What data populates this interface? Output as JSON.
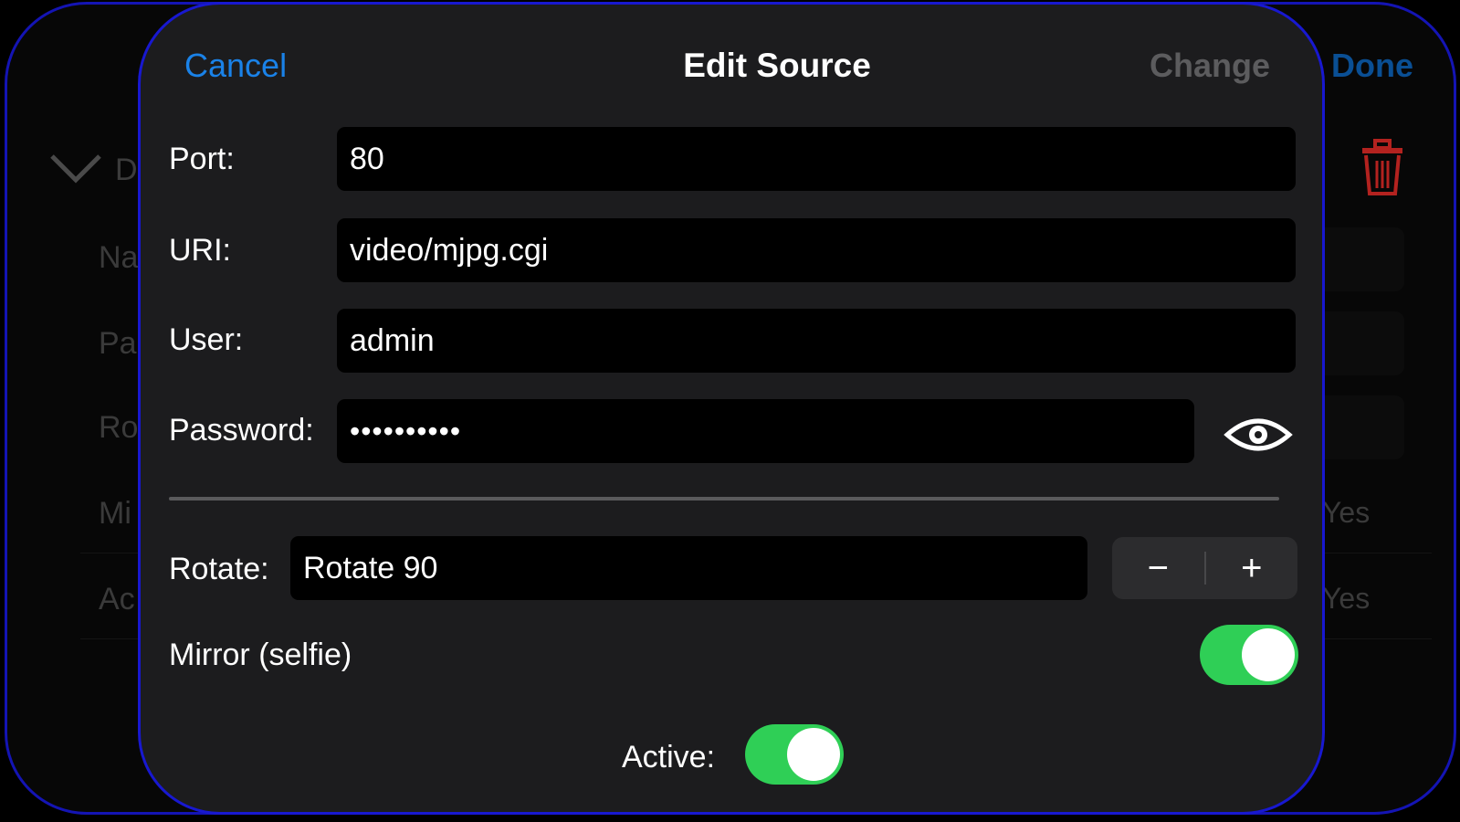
{
  "background": {
    "done_label": "Done",
    "section_initial": "D",
    "rows": [
      "Na",
      "Pa",
      "Ro",
      "Mi",
      "Ac"
    ],
    "yes_values": [
      "Yes",
      "Yes"
    ],
    "chevron_icon": "chevron-down-icon",
    "trash_icon": "trash-icon",
    "trash_color": "#b3221f"
  },
  "sheet": {
    "title": "Edit Source",
    "cancel_label": "Cancel",
    "change_label": "Change",
    "port": {
      "label": "Port:",
      "value": "80"
    },
    "uri": {
      "label": "URI:",
      "value": "video/mjpg.cgi"
    },
    "user": {
      "label": "User:",
      "value": "admin"
    },
    "password": {
      "label": "Password:",
      "value": "••••••••••",
      "eye_icon": "eye-icon"
    },
    "rotate": {
      "label": "Rotate:",
      "value": "Rotate 90",
      "minus": "−",
      "plus": "+"
    },
    "mirror": {
      "label": "Mirror (selfie)",
      "on": true
    },
    "active": {
      "label": "Active:",
      "on": true
    },
    "colors": {
      "accent": "#1a82e8",
      "toggle_on": "#2fcf56",
      "sheet_bg": "#1c1c1e",
      "border": "#1818d0"
    }
  }
}
